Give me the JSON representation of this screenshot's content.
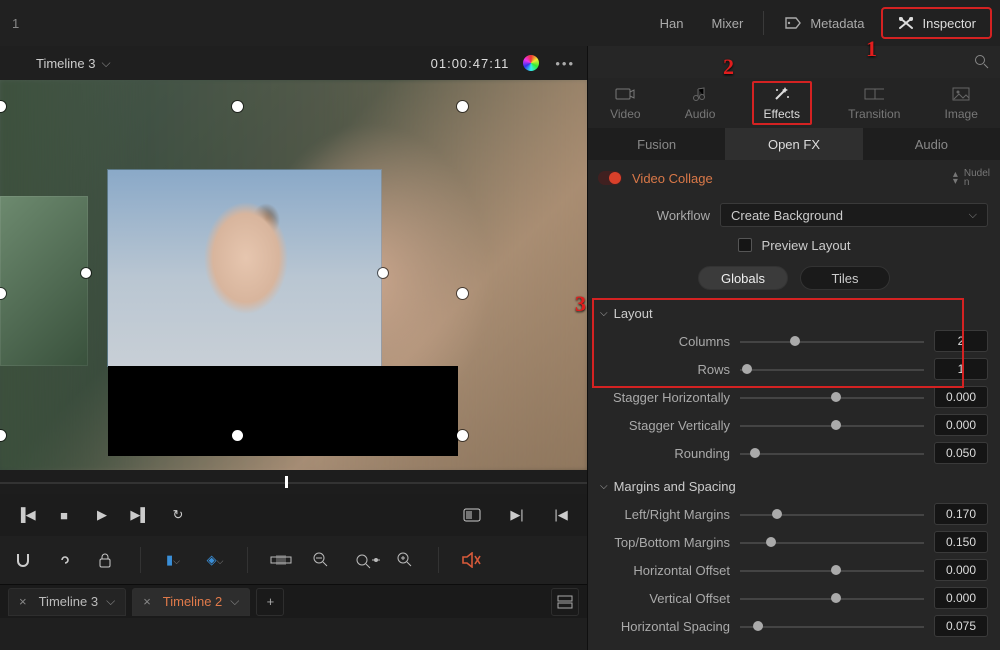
{
  "topbar": {
    "left_num": "1",
    "han": "Han",
    "mixer": "Mixer",
    "metadata": "Metadata",
    "inspector": "Inspector"
  },
  "viewer": {
    "timeline_name": "Timeline 3",
    "timecode": "01:00:47:11"
  },
  "tabs_bottom": {
    "t1": "Timeline 3",
    "t2": "Timeline 2"
  },
  "panel": {
    "tabs": {
      "video": "Video",
      "audio": "Audio",
      "effects": "Effects",
      "transition": "Transition",
      "image": "Image"
    },
    "subtabs": {
      "fusion": "Fusion",
      "openfx": "Open FX",
      "audio": "Audio"
    },
    "fx_title": "Video Collage",
    "nudel": "Nudel\nn",
    "workflow_label": "Workflow",
    "workflow_value": "Create Background",
    "preview_label": "Preview Layout",
    "pill_globals": "Globals",
    "pill_tiles": "Tiles",
    "layout_head": "Layout",
    "margins_head": "Margins and Spacing",
    "params": {
      "columns": {
        "label": "Columns",
        "value": "2",
        "pos": 30
      },
      "rows": {
        "label": "Rows",
        "value": "1",
        "pos": 4
      },
      "stag_h": {
        "label": "Stagger Horizontally",
        "value": "0.000",
        "pos": 52
      },
      "stag_v": {
        "label": "Stagger Vertically",
        "value": "0.000",
        "pos": 52
      },
      "rounding": {
        "label": "Rounding",
        "value": "0.050",
        "pos": 8
      },
      "lr_margin": {
        "label": "Left/Right Margins",
        "value": "0.170",
        "pos": 20
      },
      "tb_margin": {
        "label": "Top/Bottom Margins",
        "value": "0.150",
        "pos": 17
      },
      "h_offset": {
        "label": "Horizontal Offset",
        "value": "0.000",
        "pos": 52
      },
      "v_offset": {
        "label": "Vertical Offset",
        "value": "0.000",
        "pos": 52
      },
      "h_spacing": {
        "label": "Horizontal Spacing",
        "value": "0.075",
        "pos": 10
      }
    }
  },
  "callouts": {
    "c1": "1",
    "c2": "2",
    "c3": "3"
  }
}
